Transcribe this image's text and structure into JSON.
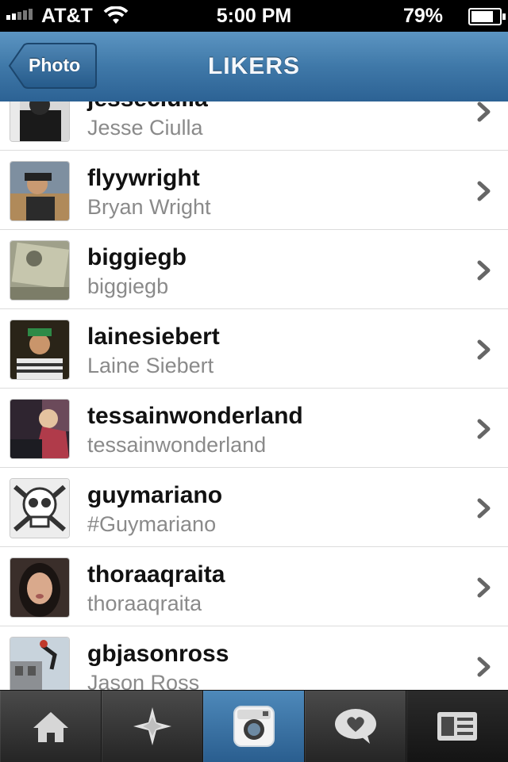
{
  "status_bar": {
    "carrier": "AT&T",
    "time": "5:00 PM",
    "battery_percent": "79%",
    "battery_level": 0.79,
    "icons": [
      "signal-icon",
      "wifi-icon",
      "battery-icon"
    ]
  },
  "nav": {
    "back_label": "Photo",
    "title": "LIKERS"
  },
  "likers": [
    {
      "username": "jesseciulla",
      "full_name": "Jesse Ciulla"
    },
    {
      "username": "flyywright",
      "full_name": "Bryan Wright"
    },
    {
      "username": "biggiegb",
      "full_name": "biggiegb"
    },
    {
      "username": "lainesiebert",
      "full_name": "Laine Siebert"
    },
    {
      "username": "tessainwonderland",
      "full_name": "tessainwonderland"
    },
    {
      "username": "guymariano",
      "full_name": "#Guymariano"
    },
    {
      "username": "thoraaqraita",
      "full_name": "thoraaqraita"
    },
    {
      "username": "gbjasonross",
      "full_name": "Jason Ross"
    }
  ],
  "tab_bar": {
    "tabs": [
      {
        "icon": "home-icon",
        "state": "normal"
      },
      {
        "icon": "explore-star-icon",
        "state": "normal"
      },
      {
        "icon": "camera-icon",
        "state": "active"
      },
      {
        "icon": "news-heart-bubble-icon",
        "state": "normal"
      },
      {
        "icon": "profile-card-icon",
        "state": "dark"
      }
    ]
  },
  "colors": {
    "nav_blue": "#3f78a8",
    "active_tab_blue": "#3a72a4",
    "secondary_text": "#8a8a8a"
  }
}
